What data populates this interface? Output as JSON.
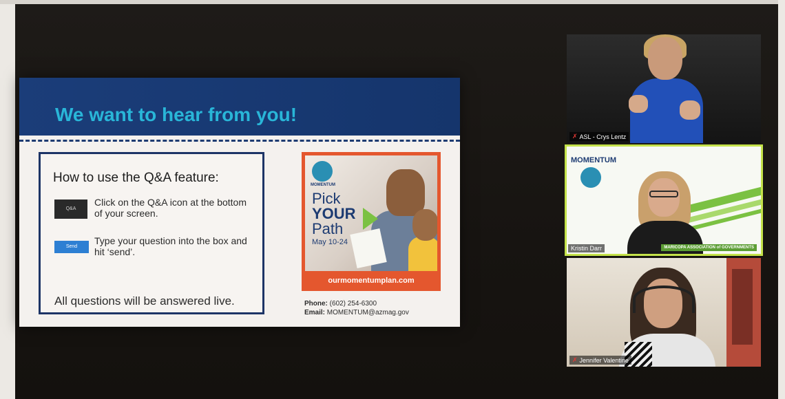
{
  "slide": {
    "title": "We want to hear from you!",
    "howto": {
      "title": "How to use the Q&A feature:",
      "qa_icon_label": "Q&A",
      "step1": "Click on the Q&A icon at the bottom of your screen.",
      "send_label": "Send",
      "step2": "Type your question into the box and hit ‘send’.",
      "footer": "All questions will be answered live."
    },
    "poster": {
      "logo_text": "MOMENTUM",
      "headline_1": "Pick",
      "headline_2": "YOUR",
      "headline_3": "Path",
      "dates": "May 10-24",
      "url": "ourmomentumplan.com"
    },
    "contact": {
      "phone_label": "Phone:",
      "phone": "(602) 254-6300",
      "email_label": "Email:",
      "email": "MOMENTUM@azmag.gov"
    }
  },
  "participants": [
    {
      "name": "ASL - Crys Lentz",
      "muted": true
    },
    {
      "name": "Kristin Darr",
      "muted": false,
      "logo_text": "MOMENTUM",
      "org_badge": "MARICOPA ASSOCIATION of GOVERNMENTS"
    },
    {
      "name": "Jennifer Valentine",
      "muted": true
    }
  ],
  "colors": {
    "slide_header": "#1b3d79",
    "slide_title": "#29b6d8",
    "active_speaker_border": "#c4e24a",
    "poster_accent": "#e4572e",
    "send_button": "#2d7fd3"
  }
}
